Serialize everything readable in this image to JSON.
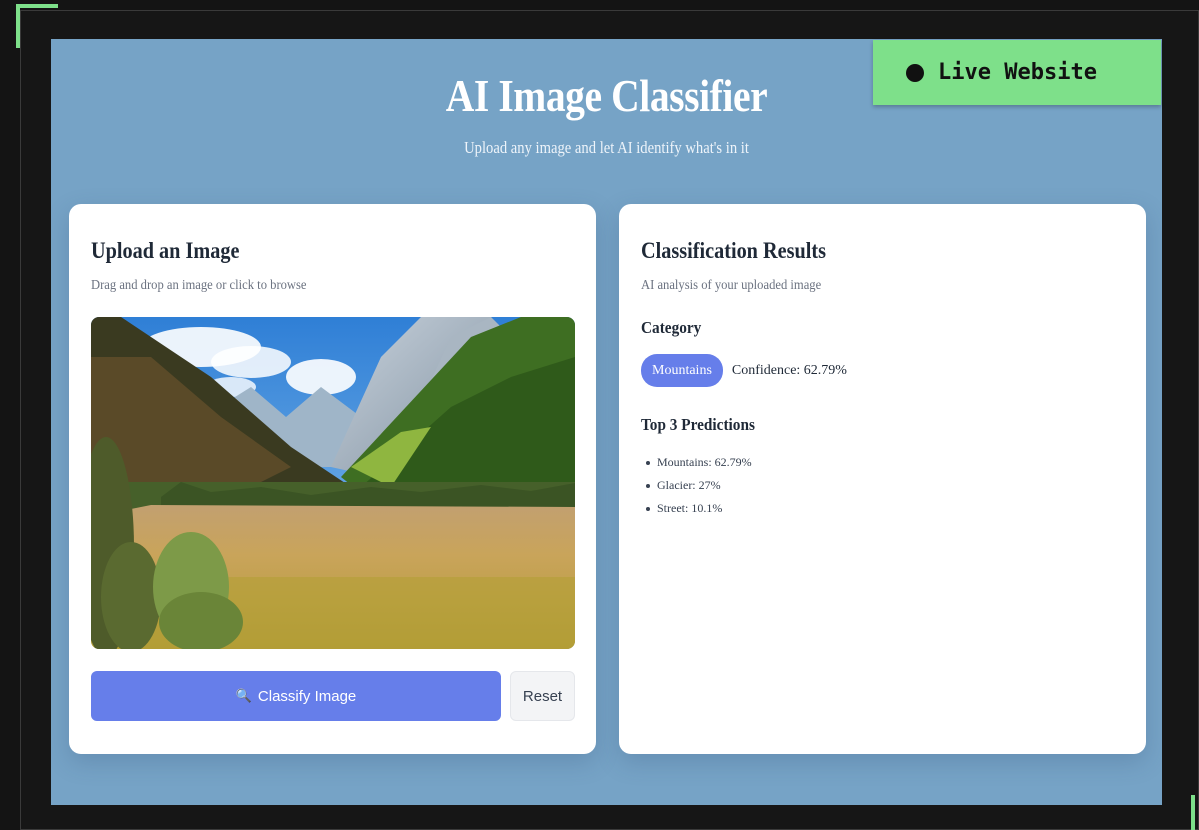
{
  "badge": {
    "label": "Live Website"
  },
  "header": {
    "title": "AI Image Classifier",
    "subtitle": "Upload any image and let AI identify what's in it"
  },
  "upload": {
    "title": "Upload an Image",
    "description": "Drag and drop an image or click to browse",
    "image_alt": "mountain valley",
    "classify_label": "Classify Image",
    "classify_icon": "magnifier-icon",
    "reset_label": "Reset"
  },
  "results": {
    "title": "Classification Results",
    "description": "AI analysis of your uploaded image",
    "category_heading": "Category",
    "category": "Mountains",
    "confidence": "Confidence: 62.79%",
    "predictions_heading": "Top 3 Predictions",
    "predictions": [
      "Mountains: 62.79%",
      "Glacier: 27%",
      "Street: 10.1%"
    ]
  },
  "colors": {
    "accent": "#667eea",
    "background": "#76a3c6",
    "badge": "#7ee08a"
  }
}
